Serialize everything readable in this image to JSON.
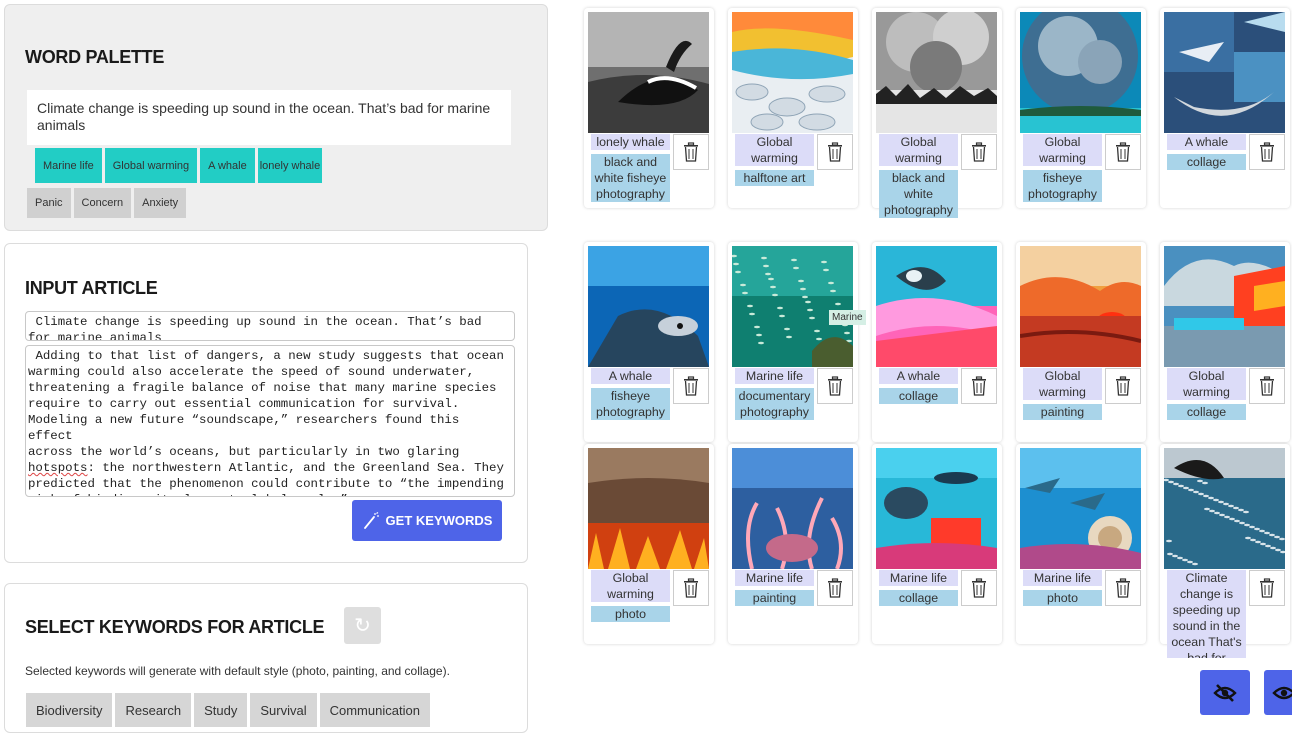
{
  "palette": {
    "heading": "WORD PALETTE",
    "title": "Climate change is speeding up sound in the ocean. That’s bad for marine animals",
    "keywords": [
      "Marine life",
      "Global warming",
      "A whale",
      "lonely whale"
    ],
    "emotions": [
      "Panic",
      "Concern",
      "Anxiety"
    ]
  },
  "input": {
    "heading": "INPUT ARTICLE",
    "title_text": " Climate change is speeding up sound in the ocean. That’s bad\nfor marine animals",
    "body_before": " Adding to that list of dangers, a new study suggests that ocean\nwarming could also accelerate the speed of sound underwater,\nthreatening a fragile balance of noise that many marine species\nrequire to carry out essential communication for survival.\nModeling a new future “soundscape,” researchers found this effect\nacross the world’s oceans, but particularly in two glaring\n",
    "body_misspelled": "hotspots",
    "body_after": ": the northwestern Atlantic, and the Greenland Sea. They\npredicted that the phenomenon could contribute to “the impending\nrisk of biodiversity loss at global scale.”",
    "button_label": "GET KEYWORDS"
  },
  "select": {
    "heading": "SELECT KEYWORDS FOR ARTICLE",
    "note": "Selected keywords will generate with default style (photo, painting, and collage).",
    "keywords": [
      "Biodiversity",
      "Research",
      "Study",
      "Survival",
      "Communication"
    ]
  },
  "gallery": [
    {
      "keyword": "lonely whale",
      "style": "black and white fisheye photography",
      "scene": "bw-whale"
    },
    {
      "keyword": "Global warming",
      "style": "halftone art",
      "scene": "halftone"
    },
    {
      "keyword": "Global warming",
      "style": "black and white photography",
      "scene": "bw-storm"
    },
    {
      "keyword": "Global warming",
      "style": "fisheye photography",
      "scene": "fisheye-globe"
    },
    {
      "keyword": "A whale",
      "style": "collage",
      "scene": "whale-collage"
    },
    {
      "keyword": "A whale",
      "style": "fisheye photography",
      "scene": "underwater-whale"
    },
    {
      "keyword": "Marine life",
      "style": "documentary photography",
      "scene": "fish-school"
    },
    {
      "keyword": "A whale",
      "style": "collage",
      "scene": "pink-collage"
    },
    {
      "keyword": "Global warming",
      "style": "painting",
      "scene": "sunset-painting"
    },
    {
      "keyword": "Global warming",
      "style": "collage",
      "scene": "ice-collage"
    },
    {
      "keyword": "Global warming",
      "style": "photo",
      "scene": "fire"
    },
    {
      "keyword": "Marine life",
      "style": "painting",
      "scene": "coral-painting"
    },
    {
      "keyword": "Marine life",
      "style": "collage",
      "scene": "reef-collage"
    },
    {
      "keyword": "Marine life",
      "style": "photo",
      "scene": "reef-photo"
    },
    {
      "keyword": "Climate change is speeding up sound in the ocean That's bad for",
      "style": "",
      "scene": "dark-fish"
    }
  ],
  "tooltip": "Marine",
  "icons": {
    "generate": "magic-wand-icon",
    "refresh": "refresh-icon",
    "delete": "trash-icon",
    "hide": "eye-slash-icon",
    "show": "eye-icon"
  },
  "colors": {
    "accent": "#4e64e8",
    "palette_chip": "#22cdc5",
    "keyword_label": "#dcdcf8",
    "style_label": "#a9d4e9"
  }
}
